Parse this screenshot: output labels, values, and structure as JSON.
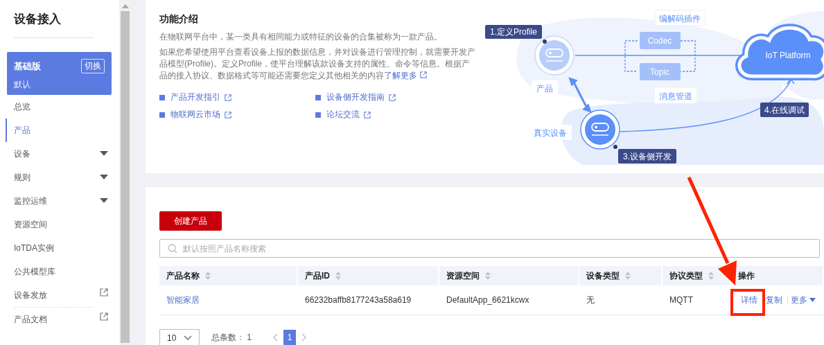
{
  "sidebar": {
    "title": "设备接入",
    "edition": {
      "name": "基础版",
      "switch_label": "切换",
      "instance": "默认"
    },
    "items": [
      {
        "label": "总览",
        "kind": "plain",
        "selected": false
      },
      {
        "label": "产品",
        "kind": "plain",
        "selected": true
      },
      {
        "label": "设备",
        "kind": "expandable",
        "selected": false
      },
      {
        "label": "规则",
        "kind": "expandable",
        "selected": false
      },
      {
        "label": "监控运维",
        "kind": "expandable",
        "selected": false
      },
      {
        "label": "资源空间",
        "kind": "plain",
        "selected": false
      },
      {
        "label": "IoTDA实例",
        "kind": "plain",
        "selected": false
      },
      {
        "label": "公共模型库",
        "kind": "plain",
        "selected": false
      },
      {
        "label": "设备发放",
        "kind": "external",
        "selected": false
      },
      {
        "label": "产品文档",
        "kind": "external",
        "selected": false
      }
    ]
  },
  "intro": {
    "title": "功能介绍",
    "paragraphs": [
      {
        "text": "在物联网平台中，某一类具有相同能力或特征的设备的合集被称为一款产品。"
      },
      {
        "text": "如果您希望使用平台查看设备上报的数据信息，并对设备进行管理控制，就需要开发产品模型(Profile)。定义Profile，使平台理解该款设备支持的属性、命令等信息。根据产品的接入协议、数据格式等可能还需要您定义其他相关的内容",
        "link": "了解更多"
      }
    ],
    "links": [
      "产品开发指引",
      "设备侧开发指南",
      "物联网云市场",
      "论坛交流"
    ]
  },
  "diagram": {
    "steps": [
      "1.定义Profile",
      "3.设备侧开发",
      "4.在线调试"
    ],
    "product_label": "产品",
    "device_label": "真实设备",
    "codec": "Codec",
    "topic": "Topic",
    "codec_note": "编解码插件",
    "topic_note": "消息管道",
    "platform": "IoT Platform"
  },
  "products": {
    "create_button": "创建产品",
    "search": {
      "placeholder": "默认按照产品名称搜索"
    },
    "columns": [
      {
        "label": "产品名称",
        "sortable": true
      },
      {
        "label": "产品ID",
        "sortable": true
      },
      {
        "label": "资源空间",
        "sortable": true
      },
      {
        "label": "设备类型",
        "sortable": true
      },
      {
        "label": "协议类型",
        "sortable": true
      },
      {
        "label": "操作",
        "sortable": false
      }
    ],
    "rows": [
      {
        "cells": [
          "智能家居",
          "66232baffb8177243a58a619",
          "DefaultApp_6621kcwx",
          "无",
          "MQTT"
        ],
        "actions": [
          {
            "label": "详情",
            "dropdown": false
          },
          {
            "label": "复制",
            "dropdown": false
          },
          {
            "label": "更多",
            "dropdown": true
          }
        ]
      }
    ],
    "pagination": {
      "page_size": "10",
      "total": "总条数： 1",
      "pages": [
        {
          "label": "1",
          "selected": true
        }
      ]
    }
  }
}
